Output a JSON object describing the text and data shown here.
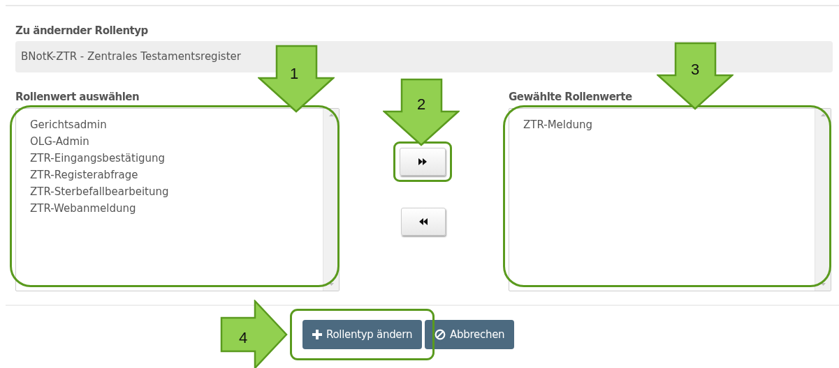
{
  "role_type": {
    "label": "Zu ändernder Rollentyp",
    "value": "BNotK-ZTR - Zentrales Testamentsregister"
  },
  "available": {
    "label": "Rollenwert auswählen",
    "highlighted": true,
    "items": [
      "Gerichtsadmin",
      "OLG-Admin",
      "ZTR-Eingangsbestätigung",
      "ZTR-Registerabfrage",
      "ZTR-Sterbefallbearbeitung",
      "ZTR-Webanmeldung"
    ]
  },
  "move_buttons": [
    {
      "kind": "add",
      "highlighted": true
    },
    {
      "kind": "remove",
      "highlighted": false
    }
  ],
  "selected_values": {
    "label": "Gewählte Rollenwerte",
    "highlighted": true,
    "items": [
      "ZTR-Meldung"
    ]
  },
  "buttons": [
    {
      "kind": "add",
      "label": "Rollentyp ändern",
      "highlighted": true
    },
    {
      "kind": "cancel",
      "label": "Abbrechen",
      "highlighted": false
    }
  ],
  "callouts": [
    {
      "number": "1",
      "kind": "down"
    },
    {
      "number": "2",
      "kind": "down"
    },
    {
      "number": "3",
      "kind": "down"
    },
    {
      "number": "4",
      "kind": "right"
    }
  ]
}
